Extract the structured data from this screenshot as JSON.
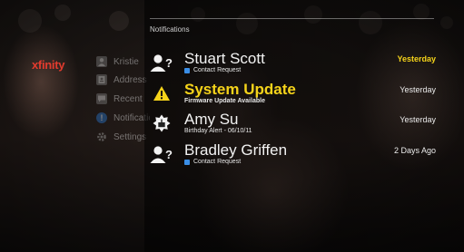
{
  "brand": {
    "logo_text": "xfinity"
  },
  "sidebar": {
    "items": [
      {
        "label": "Kristie",
        "icon": "user-icon"
      },
      {
        "label": "Address",
        "icon": "address-book-icon"
      },
      {
        "label": "Recent",
        "icon": "chat-icon"
      },
      {
        "label": "Notifications",
        "icon": "alert-icon",
        "active": true
      },
      {
        "label": "Settings",
        "icon": "gear-icon"
      }
    ]
  },
  "panel": {
    "title": "Notifications"
  },
  "notifications": [
    {
      "name": "Stuart Scott",
      "subtitle": "Contact Request",
      "time": "Yesterday",
      "icon": "contact-request-icon",
      "time_highlight": true
    },
    {
      "name": "System Update",
      "subtitle": "Firmware Update Available",
      "time": "Yesterday",
      "icon": "warning-icon",
      "highlight": true
    },
    {
      "name": "Amy Su",
      "subtitle": "Birthday Alert - 06/10/11",
      "time": "Yesterday",
      "icon": "birthday-icon"
    },
    {
      "name": "Bradley Griffen",
      "subtitle": "Contact Request",
      "time": "2 Days Ago",
      "icon": "contact-request-icon"
    }
  ],
  "colors": {
    "accent": "#f5d31a",
    "brand": "#e23b2e",
    "badge": "#3a8ee6"
  }
}
